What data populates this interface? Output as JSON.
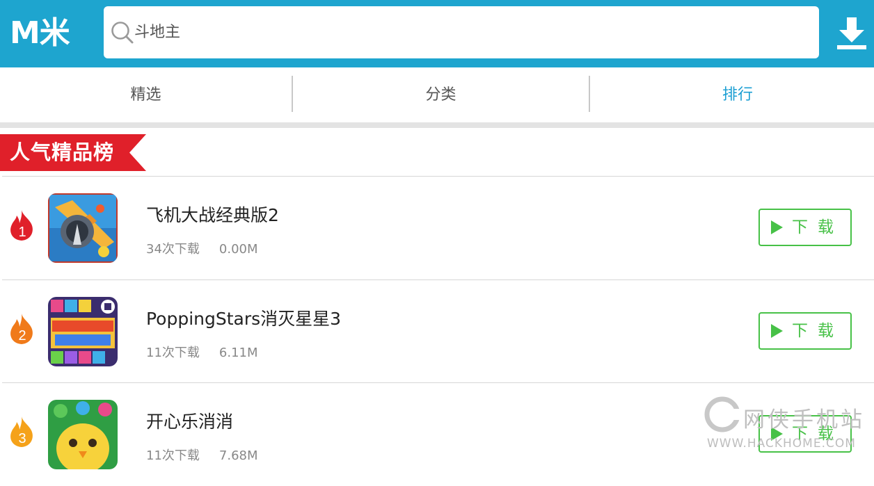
{
  "header": {
    "logo": "M米",
    "search": {
      "placeholder": "斗地主",
      "icon": "search-icon"
    },
    "download_icon": "download-icon",
    "accent_color": "#1ea5cf"
  },
  "tabs": [
    {
      "label": "精选",
      "active": false
    },
    {
      "label": "分类",
      "active": false
    },
    {
      "label": "排行",
      "active": true
    }
  ],
  "section": {
    "title": "人气精品榜",
    "banner_color": "#e0202a"
  },
  "apps": [
    {
      "rank": "1",
      "name": "飞机大战经典版2",
      "downloads": "34次下载",
      "size": "0.00M",
      "button": "下载",
      "rank_color": "#e0202a",
      "icon": "airplane-battle-icon"
    },
    {
      "rank": "2",
      "name": "PoppingStars消灭星星3",
      "downloads": "11次下载",
      "size": "6.11M",
      "button": "下载",
      "rank_color": "#f07a1a",
      "icon": "popping-stars-icon"
    },
    {
      "rank": "3",
      "name": "开心乐消消",
      "downloads": "11次下载",
      "size": "7.68M",
      "button": "下载",
      "rank_color": "#f5a21a",
      "icon": "happy-match-icon"
    }
  ],
  "watermark": {
    "text": "网侠手机站",
    "url": "WWW.HACKHOME.COM"
  }
}
